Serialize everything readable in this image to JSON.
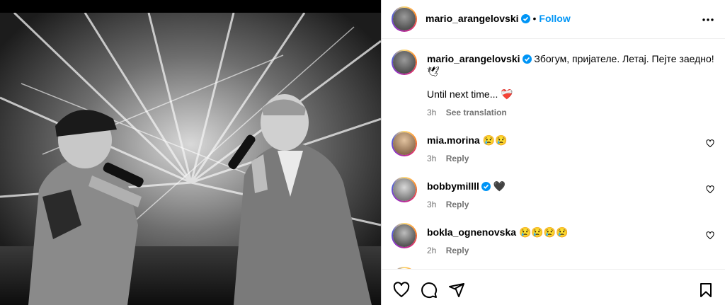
{
  "post": {
    "author": "mario_arangelovski",
    "follow_label": "Follow",
    "dot": "•",
    "caption_line1": "Збогум, пријателе. Летај. Пејте заедно!",
    "caption_line1_emoji": "🕊",
    "caption_line2": "Until next time...",
    "caption_line2_emoji": "❤️‍🩹",
    "caption_time": "3h",
    "see_translation": "See translation"
  },
  "comments": [
    {
      "user": "mia.morina",
      "verified": false,
      "text": "😢😢",
      "time": "3h",
      "reply": "Reply"
    },
    {
      "user": "bobbymillll",
      "verified": true,
      "text": "🖤",
      "time": "3h",
      "reply": "Reply"
    },
    {
      "user": "bokla_ognenovska",
      "verified": false,
      "text": "😢😢😢😢",
      "time": "2h",
      "reply": "Reply"
    }
  ],
  "icons": {
    "more": "more-options-icon",
    "like": "heart-icon",
    "comment": "comment-icon",
    "share": "send-icon",
    "save": "bookmark-icon"
  },
  "colors": {
    "accent": "#0095f6",
    "verified": "#0095f6",
    "muted": "#737373"
  }
}
